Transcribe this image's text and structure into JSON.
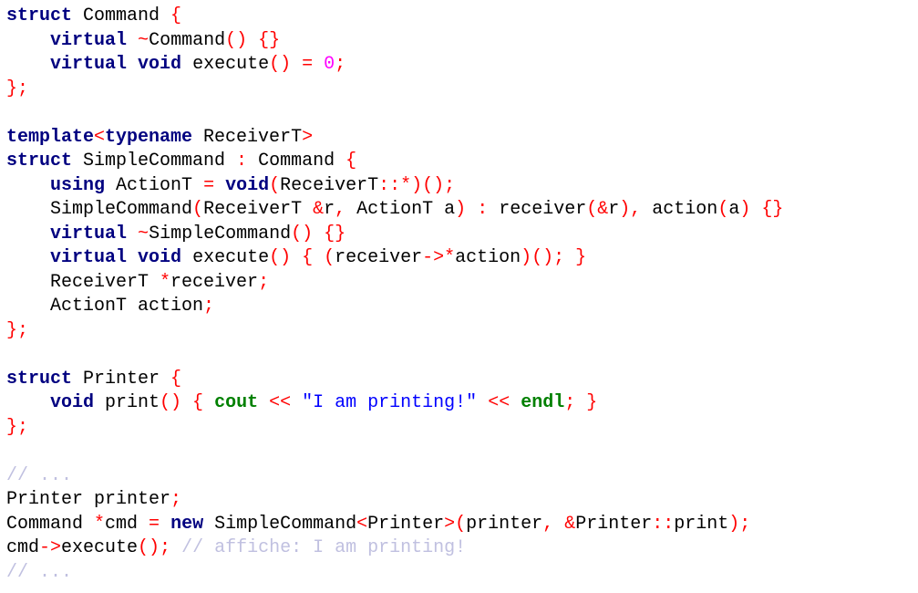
{
  "colors": {
    "keyword": "#000080",
    "punctuation": "#ff0000",
    "identifier": "#000000",
    "number": "#ff00ff",
    "string": "#0000ff",
    "stream": "#008000",
    "comment": "#c0c0e0"
  },
  "code": {
    "lines": [
      [
        [
          "struct",
          "k"
        ],
        [
          " Command ",
          "i"
        ],
        [
          "{",
          "p"
        ]
      ],
      [
        [
          "    ",
          "i"
        ],
        [
          "virtual",
          "k"
        ],
        [
          " ",
          "i"
        ],
        [
          "~",
          "p"
        ],
        [
          "Command",
          "i"
        ],
        [
          "() {}",
          "p"
        ]
      ],
      [
        [
          "    ",
          "i"
        ],
        [
          "virtual",
          "k"
        ],
        [
          " ",
          "i"
        ],
        [
          "void",
          "k"
        ],
        [
          " execute",
          "i"
        ],
        [
          "()",
          "p"
        ],
        [
          " ",
          "i"
        ],
        [
          "=",
          "p"
        ],
        [
          " ",
          "i"
        ],
        [
          "0",
          "n"
        ],
        [
          ";",
          "p"
        ]
      ],
      [
        [
          "};",
          "p"
        ]
      ],
      [],
      [
        [
          "template",
          "k"
        ],
        [
          "<",
          "p"
        ],
        [
          "typename",
          "k"
        ],
        [
          " ReceiverT",
          "i"
        ],
        [
          ">",
          "p"
        ]
      ],
      [
        [
          "struct",
          "k"
        ],
        [
          " SimpleCommand ",
          "i"
        ],
        [
          ":",
          "p"
        ],
        [
          " Command ",
          "i"
        ],
        [
          "{",
          "p"
        ]
      ],
      [
        [
          "    ",
          "i"
        ],
        [
          "using",
          "k"
        ],
        [
          " ActionT ",
          "i"
        ],
        [
          "=",
          "p"
        ],
        [
          " ",
          "i"
        ],
        [
          "void",
          "k"
        ],
        [
          "(",
          "p"
        ],
        [
          "ReceiverT",
          "i"
        ],
        [
          "::*)();",
          "p"
        ]
      ],
      [
        [
          "    SimpleCommand",
          "i"
        ],
        [
          "(",
          "p"
        ],
        [
          "ReceiverT ",
          "i"
        ],
        [
          "&",
          "p"
        ],
        [
          "r",
          "i"
        ],
        [
          ",",
          "p"
        ],
        [
          " ActionT a",
          "i"
        ],
        [
          ")",
          "p"
        ],
        [
          " ",
          "i"
        ],
        [
          ":",
          "p"
        ],
        [
          " receiver",
          "i"
        ],
        [
          "(&",
          "p"
        ],
        [
          "r",
          "i"
        ],
        [
          "),",
          "p"
        ],
        [
          " action",
          "i"
        ],
        [
          "(",
          "p"
        ],
        [
          "a",
          "i"
        ],
        [
          ") {}",
          "p"
        ]
      ],
      [
        [
          "    ",
          "i"
        ],
        [
          "virtual",
          "k"
        ],
        [
          " ",
          "i"
        ],
        [
          "~",
          "p"
        ],
        [
          "SimpleCommand",
          "i"
        ],
        [
          "() {}",
          "p"
        ]
      ],
      [
        [
          "    ",
          "i"
        ],
        [
          "virtual",
          "k"
        ],
        [
          " ",
          "i"
        ],
        [
          "void",
          "k"
        ],
        [
          " execute",
          "i"
        ],
        [
          "() { (",
          "p"
        ],
        [
          "receiver",
          "i"
        ],
        [
          "->*",
          "p"
        ],
        [
          "action",
          "i"
        ],
        [
          ")(); }",
          "p"
        ]
      ],
      [
        [
          "    ReceiverT ",
          "i"
        ],
        [
          "*",
          "p"
        ],
        [
          "receiver",
          "i"
        ],
        [
          ";",
          "p"
        ]
      ],
      [
        [
          "    ActionT action",
          "i"
        ],
        [
          ";",
          "p"
        ]
      ],
      [
        [
          "};",
          "p"
        ]
      ],
      [],
      [
        [
          "struct",
          "k"
        ],
        [
          " Printer ",
          "i"
        ],
        [
          "{",
          "p"
        ]
      ],
      [
        [
          "    ",
          "i"
        ],
        [
          "void",
          "k"
        ],
        [
          " print",
          "i"
        ],
        [
          "() {",
          "p"
        ],
        [
          " ",
          "i"
        ],
        [
          "cout",
          "g"
        ],
        [
          " ",
          "i"
        ],
        [
          "<<",
          "p"
        ],
        [
          " ",
          "i"
        ],
        [
          "\"I am printing!\"",
          "s"
        ],
        [
          " ",
          "i"
        ],
        [
          "<<",
          "p"
        ],
        [
          " ",
          "i"
        ],
        [
          "endl",
          "g"
        ],
        [
          ";",
          "p"
        ],
        [
          " }",
          "p"
        ]
      ],
      [
        [
          "};",
          "p"
        ]
      ],
      [],
      [
        [
          "// ...",
          "c"
        ]
      ],
      [
        [
          "Printer printer",
          "i"
        ],
        [
          ";",
          "p"
        ]
      ],
      [
        [
          "Command ",
          "i"
        ],
        [
          "*",
          "p"
        ],
        [
          "cmd ",
          "i"
        ],
        [
          "=",
          "p"
        ],
        [
          " ",
          "i"
        ],
        [
          "new",
          "k"
        ],
        [
          " SimpleCommand",
          "i"
        ],
        [
          "<",
          "p"
        ],
        [
          "Printer",
          "i"
        ],
        [
          ">(",
          "p"
        ],
        [
          "printer",
          "i"
        ],
        [
          ", &",
          "p"
        ],
        [
          "Printer",
          "i"
        ],
        [
          "::",
          "p"
        ],
        [
          "print",
          "i"
        ],
        [
          ");",
          "p"
        ]
      ],
      [
        [
          "cmd",
          "i"
        ],
        [
          "->",
          "p"
        ],
        [
          "execute",
          "i"
        ],
        [
          "();",
          "p"
        ],
        [
          " ",
          "i"
        ],
        [
          "// affiche: I am printing!",
          "c"
        ]
      ],
      [
        [
          "// ...",
          "c"
        ]
      ]
    ]
  }
}
